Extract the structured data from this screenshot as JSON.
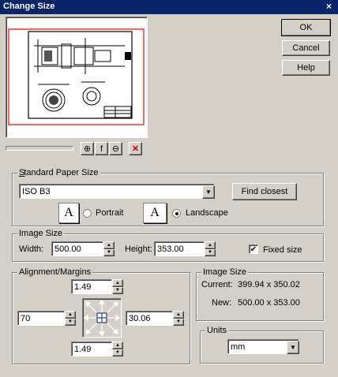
{
  "window": {
    "title": "Change Size",
    "close_glyph": "×"
  },
  "buttons": {
    "ok": "OK",
    "cancel": "Cancel",
    "help": "Help"
  },
  "toolbar": {
    "zoom_in": "⊕",
    "fit": "f",
    "zoom_out": "⊖",
    "close": "✕"
  },
  "standard_paper": {
    "group_label": "Standard Paper Size",
    "selected": "ISO B3",
    "find_closest": "Find closest",
    "portrait_label": "Portrait",
    "landscape_label": "Landscape",
    "orientation": "landscape",
    "paper_glyph": "A"
  },
  "image_size": {
    "group_label": "Image Size",
    "width_label": "Width:",
    "width_value": "500.00",
    "height_label": "Height:",
    "height_value": "353.00",
    "fixed_label": "Fixed size",
    "fixed_checked": true
  },
  "alignment": {
    "group_label": "Alignment/Margins",
    "top": "1.49",
    "left": "70",
    "right": "30.06",
    "bottom": "1.49"
  },
  "image_size_info": {
    "group_label": "Image Size",
    "current_label": "Current:",
    "current_value": "399.94 x 350.02",
    "new_label": "New:",
    "new_value": "500.00 x 353.00"
  },
  "units": {
    "group_label": "Units",
    "selected": "mm"
  },
  "colors": {
    "titlebar": "#0a246a",
    "preview_border": "#ff0000",
    "face": "#d4d0c8"
  }
}
